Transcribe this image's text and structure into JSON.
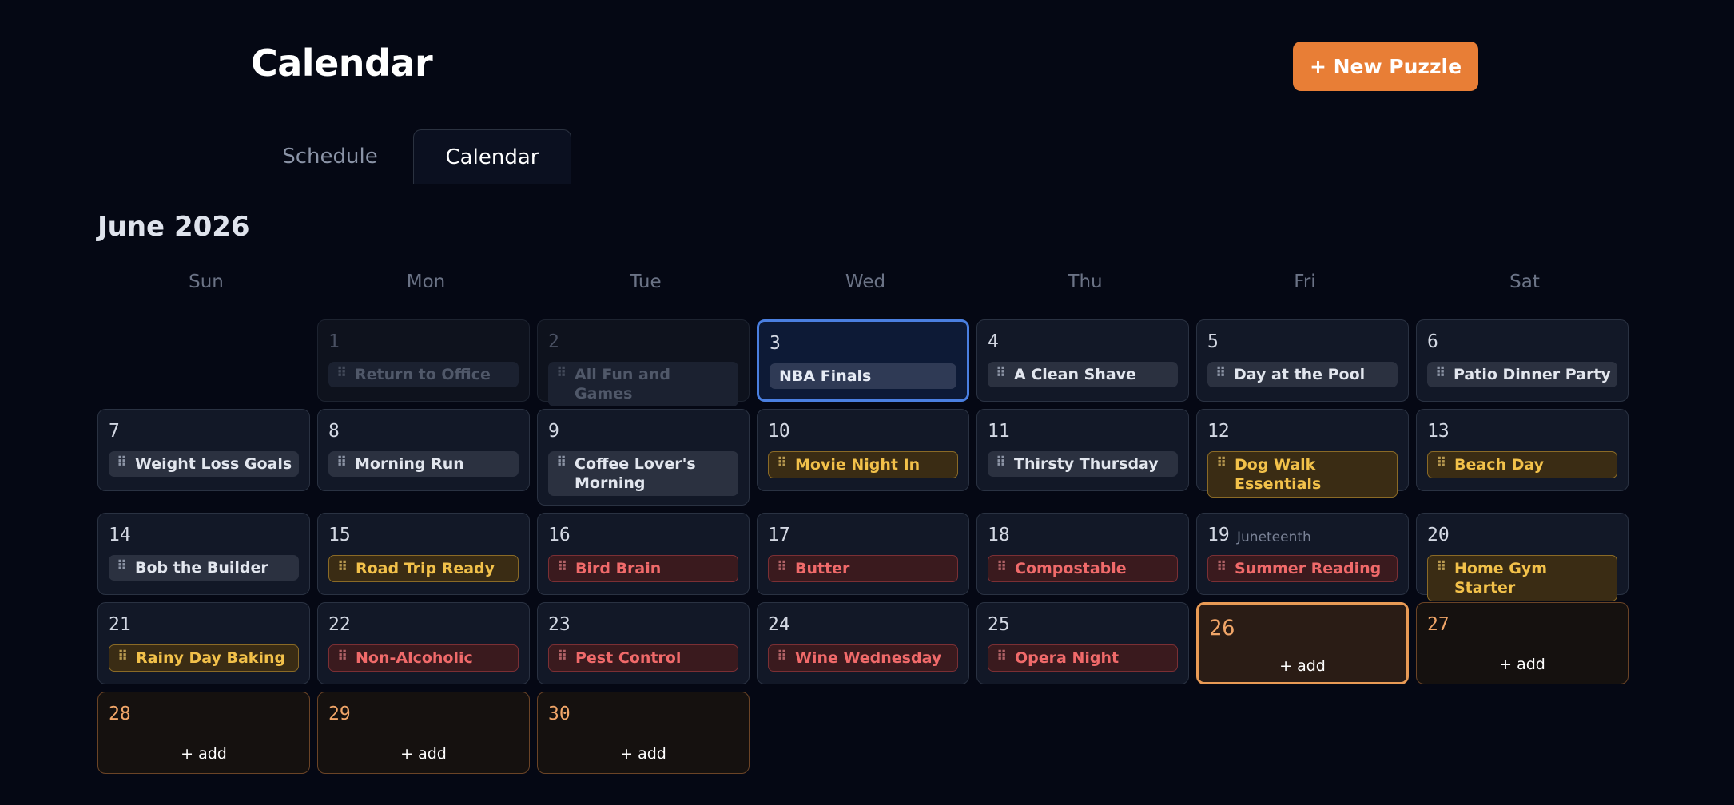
{
  "header": {
    "title": "Calendar",
    "new_button": "+ New Puzzle"
  },
  "tabs": [
    {
      "label": "Schedule"
    },
    {
      "label": "Calendar"
    }
  ],
  "month": "June 2026",
  "weekdays": [
    "Sun",
    "Mon",
    "Tue",
    "Wed",
    "Thu",
    "Fri",
    "Sat"
  ],
  "days": [
    {
      "day": "1",
      "event": "Return to Office",
      "state": "past"
    },
    {
      "day": "2",
      "event": "All Fun and Games",
      "state": "past"
    },
    {
      "day": "3",
      "event": "NBA Finals",
      "state": "selected"
    },
    {
      "day": "4",
      "event": "A Clean Shave"
    },
    {
      "day": "5",
      "event": "Day at the Pool"
    },
    {
      "day": "6",
      "event": "Patio Dinner Party"
    },
    {
      "day": "7",
      "event": "Weight Loss Goals"
    },
    {
      "day": "8",
      "event": "Morning Run"
    },
    {
      "day": "9",
      "event": "Coffee Lover's Morning"
    },
    {
      "day": "10",
      "event": "Movie Night In",
      "color": "yellow"
    },
    {
      "day": "11",
      "event": "Thirsty Thursday"
    },
    {
      "day": "12",
      "event": "Dog Walk Essentials",
      "color": "yellow"
    },
    {
      "day": "13",
      "event": "Beach Day",
      "color": "yellow"
    },
    {
      "day": "14",
      "event": "Bob the Builder"
    },
    {
      "day": "15",
      "event": "Road Trip Ready",
      "color": "yellow"
    },
    {
      "day": "16",
      "event": "Bird Brain",
      "color": "red"
    },
    {
      "day": "17",
      "event": "Butter",
      "color": "red"
    },
    {
      "day": "18",
      "event": "Compostable",
      "color": "red"
    },
    {
      "day": "19",
      "holiday": "Juneteenth",
      "event": "Summer Reading",
      "color": "red"
    },
    {
      "day": "20",
      "event": "Home Gym Starter",
      "color": "yellow"
    },
    {
      "day": "21",
      "event": "Rainy Day Baking",
      "color": "yellow"
    },
    {
      "day": "22",
      "event": "Non-Alcoholic",
      "color": "red"
    },
    {
      "day": "23",
      "event": "Pest Control",
      "color": "red"
    },
    {
      "day": "24",
      "event": "Wine Wednesday",
      "color": "red"
    },
    {
      "day": "25",
      "event": "Opera Night",
      "color": "red"
    },
    {
      "day": "26",
      "add": "+ add",
      "state": "current"
    },
    {
      "day": "27",
      "add": "+ add",
      "state": "future"
    },
    {
      "day": "28",
      "add": "+ add",
      "state": "future"
    },
    {
      "day": "29",
      "add": "+ add",
      "state": "future"
    },
    {
      "day": "30",
      "add": "+ add",
      "state": "future"
    }
  ],
  "colors": {
    "accent": "#e87e36",
    "selected_border": "#4a7fe0",
    "yellow": "#f2c14a",
    "red": "#f06a6a"
  },
  "icons": {
    "event_handle": "drag-handle-icon"
  }
}
